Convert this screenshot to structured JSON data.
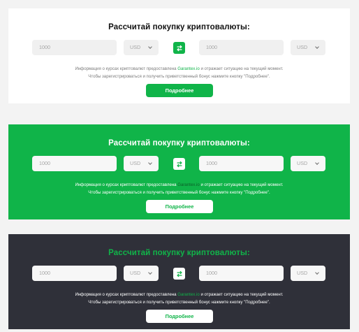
{
  "calculator": {
    "title": "Рассчитай покупку криптовалюты:",
    "from_amount": "1000",
    "from_currency": "USD",
    "to_amount": "1000",
    "to_currency": "USD",
    "info_line_1_prefix": "Информация о курсах криптовалют предоставлена ",
    "info_link": "Garantex.io",
    "info_line_1_suffix": " и отражает ситуацию на текущий момент.",
    "info_line_2": "Чтобы зарегистрироваться и получить приветственный бонус нажмите кнопку \"Подробнее\".",
    "button_label": "Подробнее"
  },
  "themes": {
    "light_bg": "#ffffff",
    "green_bg": "#10b449",
    "dark_bg": "#2f3039",
    "accent": "#10b449"
  },
  "icons": {
    "swap": "swap-arrows-icon",
    "dropdown": "chevron-down-icon"
  }
}
